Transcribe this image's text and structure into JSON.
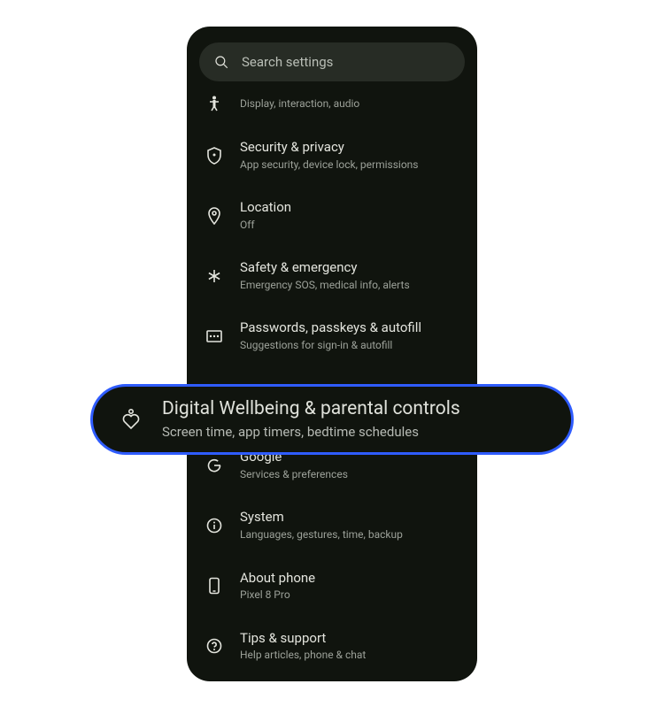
{
  "search": {
    "placeholder": "Search settings"
  },
  "partial": {
    "sub": "Display, interaction, audio"
  },
  "items": [
    {
      "title": "Security & privacy",
      "sub": "App security, device lock, permissions",
      "icon": "shield"
    },
    {
      "title": "Location",
      "sub": "Off",
      "icon": "pin"
    },
    {
      "title": "Safety & emergency",
      "sub": "Emergency SOS, medical info, alerts",
      "icon": "asterisk"
    },
    {
      "title": "Passwords, passkeys & autofill",
      "sub": "Suggestions for sign-in & autofill",
      "icon": "key"
    },
    {
      "title": "Google",
      "sub": "Services & preferences",
      "icon": "google"
    },
    {
      "title": "System",
      "sub": "Languages, gestures, time, backup",
      "icon": "info"
    },
    {
      "title": "About phone",
      "sub": "Pixel 8 Pro",
      "icon": "phone"
    },
    {
      "title": "Tips & support",
      "sub": "Help articles, phone & chat",
      "icon": "help"
    }
  ],
  "highlight": {
    "title": "Digital Wellbeing & parental controls",
    "sub": "Screen time, app timers, bedtime schedules"
  }
}
